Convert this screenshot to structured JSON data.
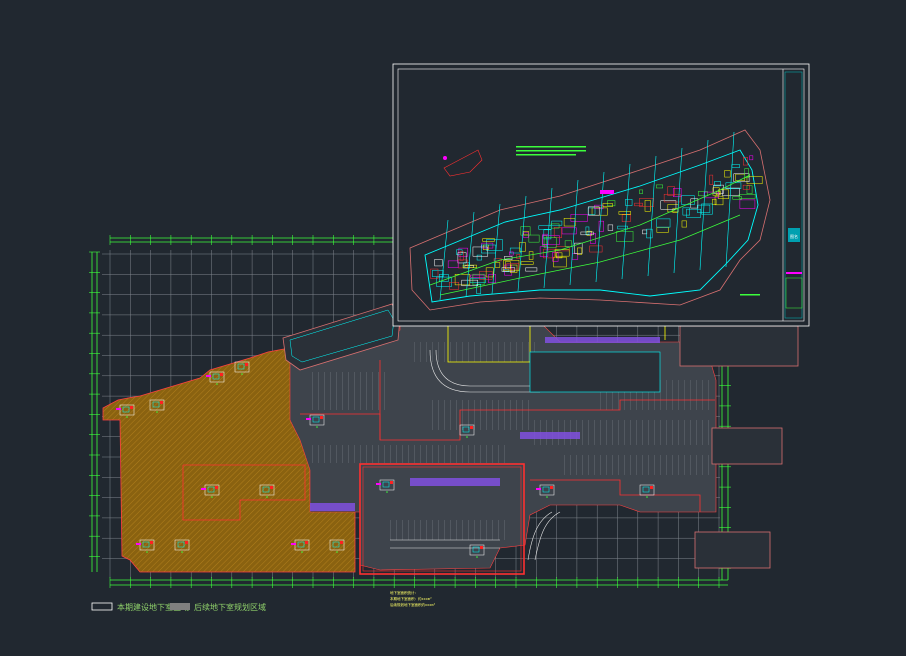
{
  "drawing": {
    "background": "#212830",
    "colors": {
      "grid": "#8a8f96",
      "grid_green": "#3cff3c",
      "cyan": "#00ffff",
      "magenta": "#ff00ff",
      "red": "#ff3030",
      "yellow": "#ffff00",
      "orange_fill": "#9a6a10",
      "white": "#ffffff",
      "pink": "#d87070",
      "purple": "#8050e0"
    }
  },
  "legend": {
    "item1_label": "本期建设地下室区域",
    "item2_label": "后续地下室规划区域"
  },
  "notes": {
    "line1": "地下室面积统计：",
    "line2": "本期地下室面积：约xxxm²",
    "line3": "后续规划地下室面积约xxxm²"
  },
  "title_block": {
    "label": "图名"
  }
}
